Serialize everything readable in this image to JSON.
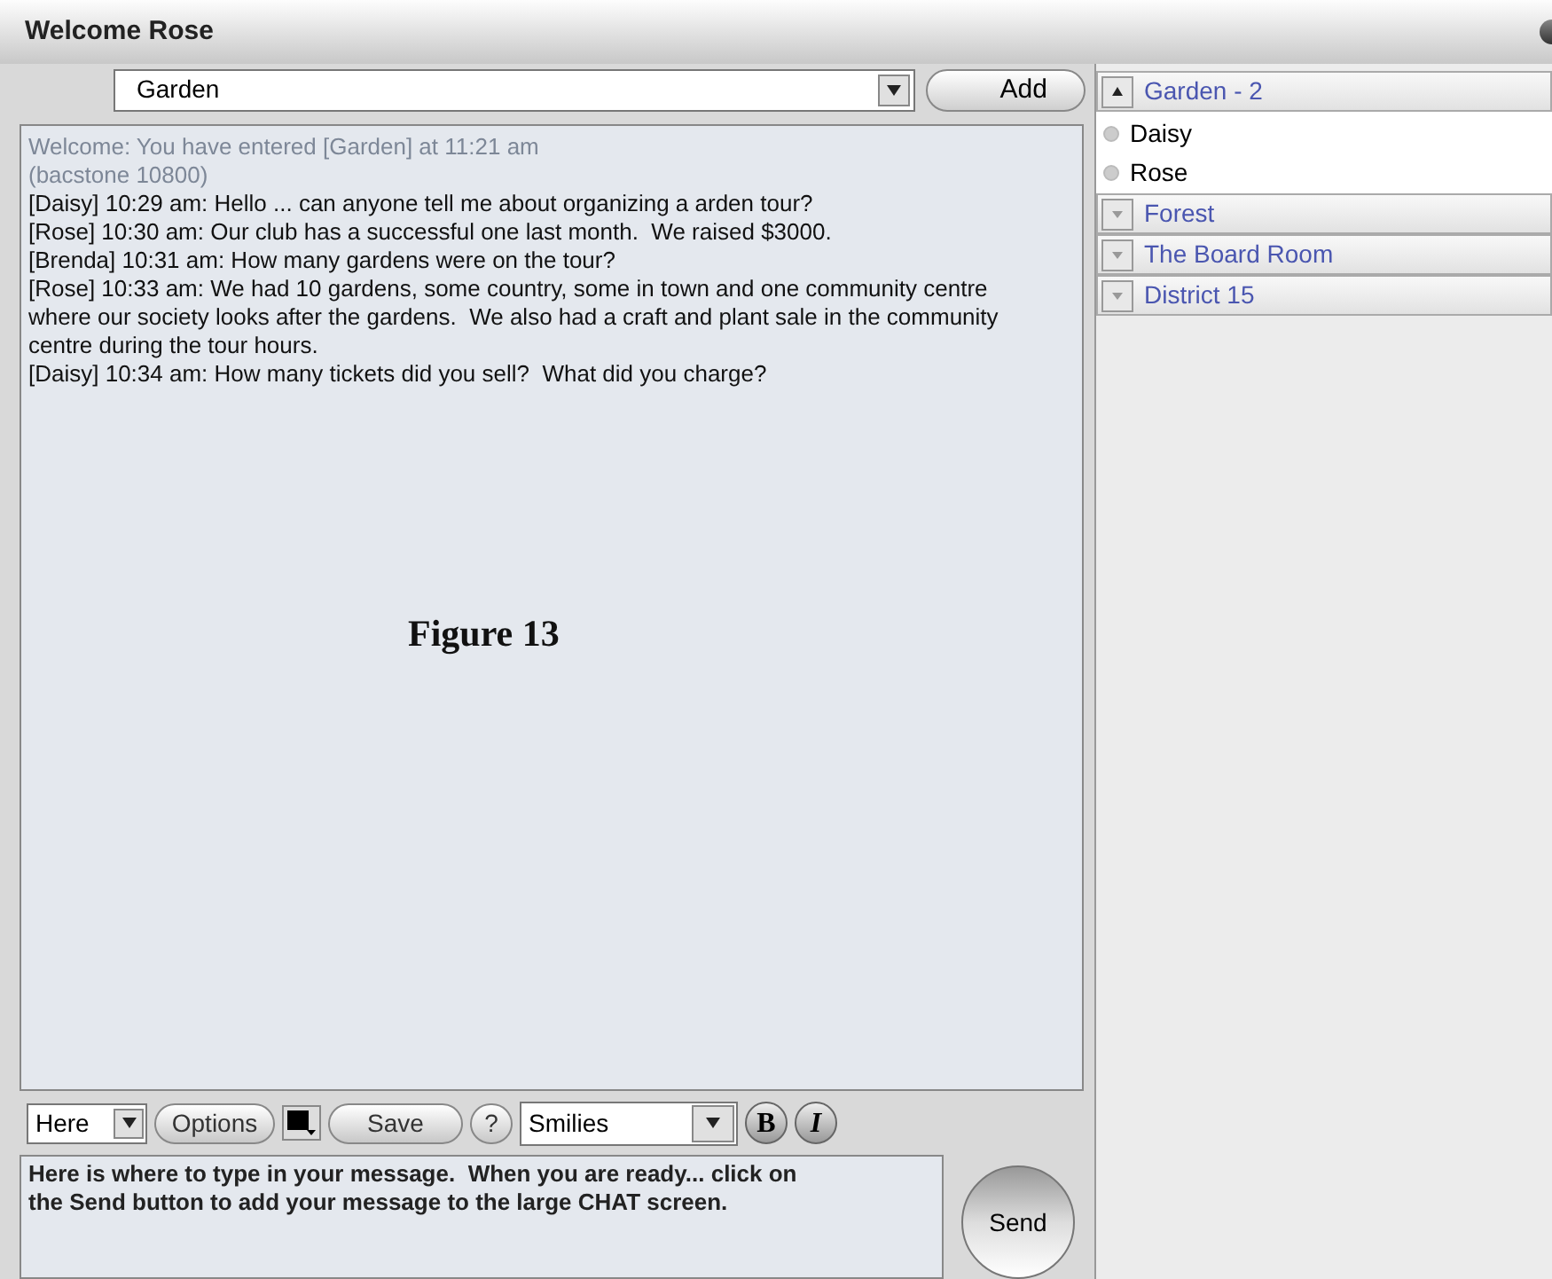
{
  "window": {
    "title": "Welcome Rose"
  },
  "room_select": {
    "value": "Garden"
  },
  "add_button": "Add",
  "chat": {
    "system_lines": [
      "Welcome: You have entered [Garden] at 11:21 am",
      "(bacstone 10800)"
    ],
    "messages": [
      "[Daisy] 10:29 am: Hello ... can anyone tell me about organizing a arden tour?",
      "[Rose] 10:30 am: Our club has a successful one last month.  We raised $3000.",
      "[Brenda] 10:31 am: How many gardens were on the tour?",
      "[Rose] 10:33 am: We had 10 gardens, some country, some in town and one community centre where our society looks after the gardens.  We also had a craft and plant sale in the community centre during the tour hours.",
      "[Daisy] 10:34 am: How many tickets did you sell?  What did you charge?"
    ],
    "caption": "Figure 13"
  },
  "toolbar": {
    "target": "Here",
    "options": "Options",
    "save": "Save",
    "help": "?",
    "smilies": "Smilies",
    "bold": "B",
    "italic": "I"
  },
  "message_box": {
    "value": "Here is where to type in your message.  When you are ready... click on the Send button to add your message to the large CHAT screen."
  },
  "send_button": "Send",
  "rooms": [
    {
      "name": "Garden - 2",
      "expanded": true,
      "users": [
        "Daisy",
        "Rose"
      ]
    },
    {
      "name": "Forest",
      "expanded": false
    },
    {
      "name": "The Board Room",
      "expanded": false
    },
    {
      "name": "District 15",
      "expanded": false
    }
  ]
}
